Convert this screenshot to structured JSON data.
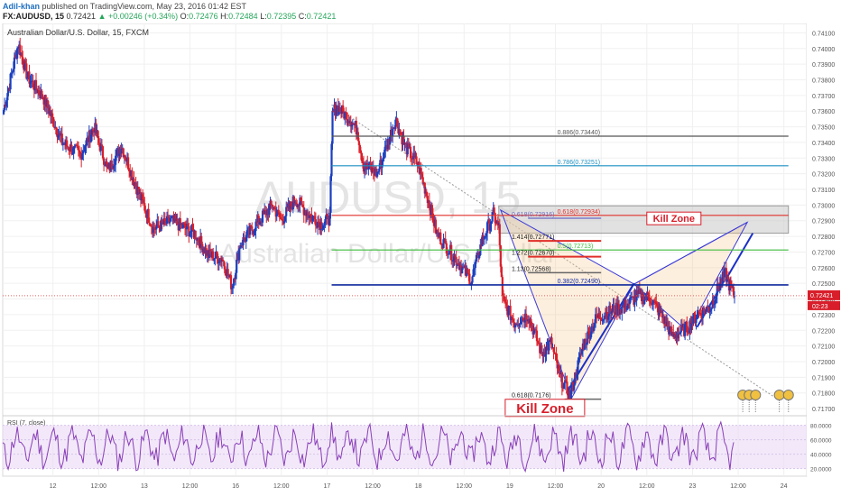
{
  "header": {
    "author": "Adil-khan",
    "published": "published on TradingView.com, May 23, 2016 01:42 EST",
    "symbol": "FX:AUDUSD, 15",
    "last": "0.72421",
    "change": "▲ +0.00246 (+0.34%)",
    "ohlc": [
      {
        "label": "O:",
        "value": "0.72476"
      },
      {
        "label": "H:",
        "value": "0.72484"
      },
      {
        "label": "L:",
        "value": "0.72395"
      },
      {
        "label": "C:",
        "value": "0.72421"
      }
    ]
  },
  "chart_data": {
    "type": "candlestick",
    "title": "Australian Dollar/U.S. Dollar, 15, FXCM",
    "watermark_symbol": "AUDUSD, 15",
    "watermark_name": "Australian Dollar/U.S. Dollar",
    "ylim": [
      0.7166,
      0.7416
    ],
    "y_ticks": [
      "0.74100",
      "0.74000",
      "0.73900",
      "0.73800",
      "0.73700",
      "0.73600",
      "0.73500",
      "0.73400",
      "0.73300",
      "0.73200",
      "0.73100",
      "0.73000",
      "0.72900",
      "0.72800",
      "0.72700",
      "0.72600",
      "0.72500",
      "0.72400",
      "0.72300",
      "0.72200",
      "0.72100",
      "0.72000",
      "0.71900",
      "0.71800",
      "0.71700"
    ],
    "x_ticks": [
      {
        "label": "12",
        "t": 12.0
      },
      {
        "label": "12:00",
        "t": 12.5
      },
      {
        "label": "13",
        "t": 13.0
      },
      {
        "label": "12:00",
        "t": 13.5
      },
      {
        "label": "16",
        "t": 14.0
      },
      {
        "label": "12:00",
        "t": 14.5
      },
      {
        "label": "17",
        "t": 15.0
      },
      {
        "label": "12:00",
        "t": 15.5
      },
      {
        "label": "18",
        "t": 16.0
      },
      {
        "label": "12:00",
        "t": 16.5
      },
      {
        "label": "19",
        "t": 17.0
      },
      {
        "label": "12:00",
        "t": 17.5
      },
      {
        "label": "20",
        "t": 18.0
      },
      {
        "label": "12:00",
        "t": 18.5
      },
      {
        "label": "23",
        "t": 19.0
      },
      {
        "label": "12:00",
        "t": 19.5
      },
      {
        "label": "24",
        "t": 20.0
      }
    ],
    "price_path": [
      [
        11.45,
        0.7358
      ],
      [
        11.62,
        0.7403
      ],
      [
        11.72,
        0.7382
      ],
      [
        11.9,
        0.7368
      ],
      [
        12.1,
        0.734
      ],
      [
        12.3,
        0.7332
      ],
      [
        12.45,
        0.735
      ],
      [
        12.6,
        0.7322
      ],
      [
        12.75,
        0.7338
      ],
      [
        12.95,
        0.7306
      ],
      [
        13.1,
        0.7285
      ],
      [
        13.3,
        0.729
      ],
      [
        13.55,
        0.7282
      ],
      [
        13.7,
        0.7268
      ],
      [
        13.85,
        0.7266
      ],
      [
        13.96,
        0.7248
      ],
      [
        14.05,
        0.7275
      ],
      [
        14.2,
        0.7286
      ],
      [
        14.4,
        0.73
      ],
      [
        14.5,
        0.729
      ],
      [
        14.65,
        0.7304
      ],
      [
        14.8,
        0.7294
      ],
      [
        14.93,
        0.7288
      ],
      [
        15.0,
        0.729
      ],
      [
        15.03,
        0.7292
      ],
      [
        15.06,
        0.7358
      ],
      [
        15.1,
        0.7363
      ],
      [
        15.25,
        0.7355
      ],
      [
        15.33,
        0.7348
      ],
      [
        15.4,
        0.7325
      ],
      [
        15.55,
        0.732
      ],
      [
        15.75,
        0.7355
      ],
      [
        15.85,
        0.7338
      ],
      [
        16.0,
        0.7325
      ],
      [
        16.1,
        0.7305
      ],
      [
        16.2,
        0.7282
      ],
      [
        16.35,
        0.727
      ],
      [
        16.5,
        0.7258
      ],
      [
        16.58,
        0.7252
      ],
      [
        16.7,
        0.7278
      ],
      [
        16.82,
        0.7294
      ],
      [
        16.88,
        0.7285
      ],
      [
        16.92,
        0.724
      ],
      [
        17.05,
        0.7225
      ],
      [
        17.2,
        0.723
      ],
      [
        17.35,
        0.7205
      ],
      [
        17.45,
        0.7212
      ],
      [
        17.55,
        0.719
      ],
      [
        17.66,
        0.7178
      ],
      [
        17.8,
        0.721
      ],
      [
        17.95,
        0.7228
      ],
      [
        18.1,
        0.7232
      ],
      [
        18.25,
        0.7235
      ],
      [
        18.4,
        0.7242
      ],
      [
        18.55,
        0.724
      ],
      [
        18.7,
        0.7226
      ],
      [
        18.78,
        0.7216
      ],
      [
        18.95,
        0.7222
      ],
      [
        19.05,
        0.723
      ],
      [
        19.2,
        0.7235
      ],
      [
        19.3,
        0.725
      ],
      [
        19.36,
        0.7256
      ],
      [
        19.42,
        0.7246
      ],
      [
        19.46,
        0.7242
      ]
    ],
    "fib_levels": [
      {
        "label": "0.886(0.73440)",
        "value": 0.7344,
        "color": "#555555"
      },
      {
        "label": "0.786(0.73251)",
        "value": 0.73251,
        "color": "#1b8fc2"
      },
      {
        "label": "0.618(0.72934)",
        "value": 0.72934,
        "color": "#e0302a"
      },
      {
        "label": "0.5(0.72713)",
        "value": 0.72713,
        "color": "#3dbb3d"
      },
      {
        "label": "0.382(0.72490)",
        "value": 0.7249,
        "color": "#102a9e"
      }
    ],
    "short_levels": [
      {
        "label": "0.618(0.72916)",
        "value": 0.72916,
        "color": "#7b7bc8"
      },
      {
        "label": "1.414(0.72771)",
        "value": 0.72771,
        "color": "#e0302a"
      },
      {
        "label": "1.272(0.72670)",
        "value": 0.7267,
        "color": "#e0302a"
      },
      {
        "label": "1.13(0.72568)",
        "value": 0.72568,
        "color": "#666666"
      },
      {
        "label": "0.618(0.7176)",
        "value": 0.7176,
        "color": "#666666"
      }
    ],
    "kill_zones": [
      {
        "label": "Kill Zone",
        "price": 0.7289
      },
      {
        "label": "Kill Zone",
        "price": 0.717
      }
    ],
    "last_price": "0.72421",
    "countdown": "02:23",
    "rsi": {
      "title": "RSI (7, close)",
      "ticks": [
        "80.0000",
        "60.0000",
        "40.0000",
        "20.0000"
      ],
      "ylim": [
        12,
        92
      ],
      "band": [
        20,
        80
      ]
    }
  }
}
